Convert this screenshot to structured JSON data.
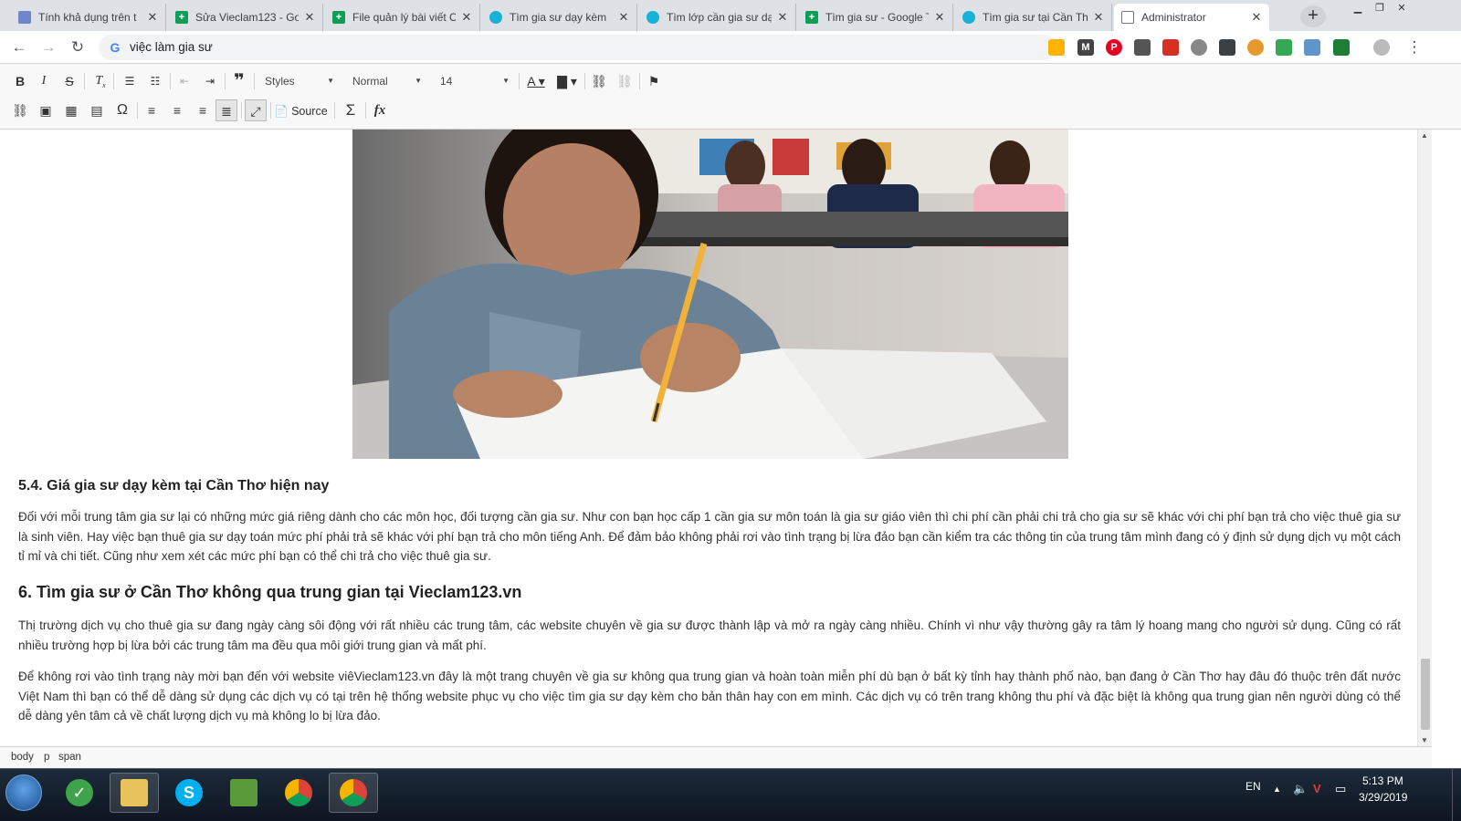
{
  "tabs": [
    {
      "title": "Tính khả dụng trên t",
      "icon": "note-icon"
    },
    {
      "title": "Sửa Vieclam123 - Go",
      "icon": "sheets-icon"
    },
    {
      "title": "File quản lý bài viết C",
      "icon": "sheets-icon"
    },
    {
      "title": "Tìm gia sư dạy kèm",
      "icon": "edu-icon"
    },
    {
      "title": "Tìm lớp cần gia sư dạ",
      "icon": "edu-icon"
    },
    {
      "title": "Tìm gia sư - Google T",
      "icon": "sheets-icon"
    },
    {
      "title": "Tìm gia sư tại Cần Th",
      "icon": "edu-icon"
    },
    {
      "title": "Administrator",
      "icon": "document-icon",
      "active": true
    }
  ],
  "address": {
    "url": "việc làm gia sư"
  },
  "editor_toolbar": {
    "styles_label": "Styles",
    "format_label": "Normal",
    "size_label": "14",
    "source_label": "Source"
  },
  "content": {
    "heading_54": "5.4. Giá gia sư dạy kèm tại Cần Thơ hiện nay",
    "para_54": "Đối với mỗi trung tâm gia sư lại có những mức giá riêng dành cho các môn học, đối tượng cần gia sư. Như con bạn học cấp 1 cần gia sư môn toán là gia sư giáo viên thì chi phí cần phải chi trả cho gia sư sẽ khác với chi phí bạn trả cho việc thuê gia sư là sinh viên. Hay việc bạn thuê gia sư dạy toán mức phí phải trả sẽ khác với phí bạn trả cho môn tiếng Anh. Để đảm bảo không phải rơi vào tình trạng bị lừa đảo bạn cần kiểm tra các thông tin của trung tâm mình đang có ý định sử dụng dịch vụ một cách tỉ mỉ và chi tiết. Cũng như xem xét các mức phí bạn có thể chi trả cho việc thuê gia sư.",
    "heading_6": "6. Tìm gia sư ở Cần Thơ không qua trung gian tại Vieclam123.vn",
    "para_6a": "Thị trường dịch vụ cho thuê gia sư đang ngày càng sôi động với rất nhiều các trung tâm, các website chuyên về gia sư được thành lập và mở ra ngày càng nhiều. Chính vì như vậy thường gây ra tâm lý hoang mang cho người sử dụng. Cũng có rất nhiều trường hợp bị lừa bởi các trung tâm ma đều qua môi giới trung gian và mất phí.",
    "para_6b": "Để không rơi vào tình trạng này mời bạn đến với website viêVieclam123.vn đây là một trang chuyên về gia sư không qua trung gian và hoàn toàn miễn phí dù bạn ở bất kỳ tỉnh hay thành phố nào, bạn đang ở Cần Thơ hay đâu đó thuộc trên đất nước Việt Nam thì bạn có thể dễ dàng sử dụng các dịch vụ có tại trên hệ thống website phục vụ cho việc tìm gia sư dạy kèm cho bản thân hay con em mình. Các dịch vụ có trên trang không thu phí và đặc biệt là không qua trung gian nên người dùng có thể dễ dàng yên tâm cả về chất lượng dịch vụ mà không lo bị lừa đảo."
  },
  "path_bar": [
    "body",
    "p",
    "span"
  ],
  "taskbar": {
    "language": "EN",
    "time": "5:13 PM",
    "date": "3/29/2019"
  }
}
